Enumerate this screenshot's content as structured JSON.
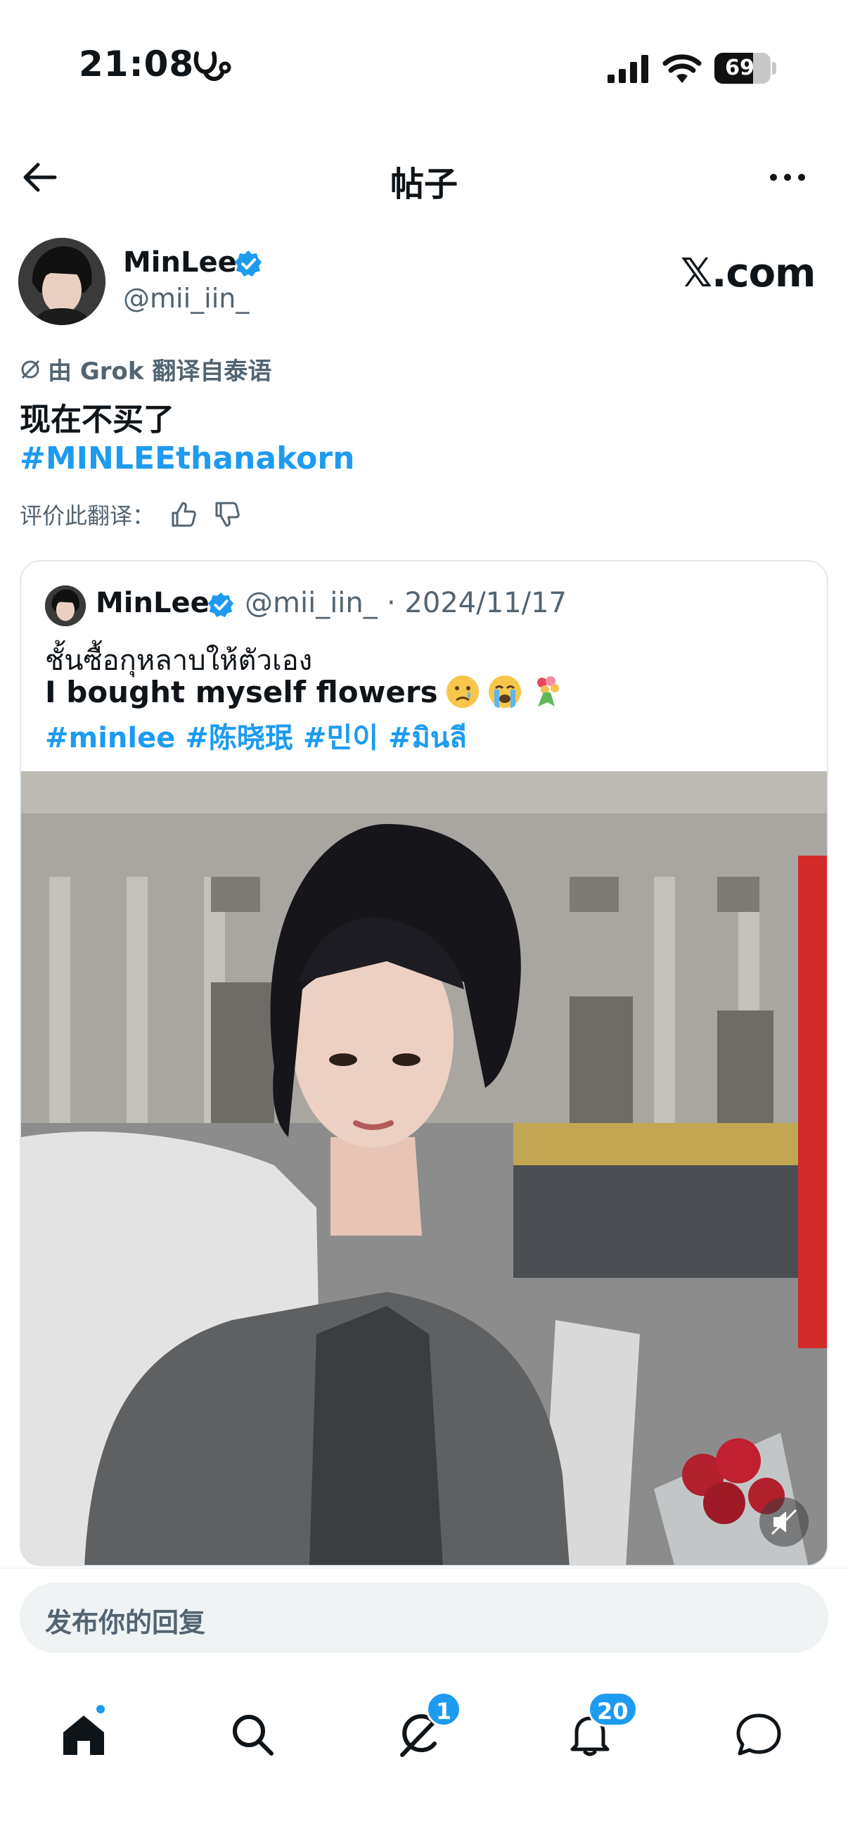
{
  "status": {
    "time": "21:08",
    "battery": "69",
    "battery_level": 0.69
  },
  "header": {
    "title": "帖子"
  },
  "author": {
    "name": "MinLee",
    "handle": "@mii_iin_",
    "site": "𝕏.com"
  },
  "post": {
    "translation_note": "由 Grok 翻译自泰语",
    "text": "现在不买了",
    "hashtag": "#MINLEEthanakorn",
    "rate_label": "评价此翻译："
  },
  "quote": {
    "name": "MinLee",
    "handle": "@mii_iin_",
    "date": "· 2024/11/17",
    "line1": "ชั้นซื้อกุหลาบให้ตัวเอง",
    "line2": "I bought myself flowers",
    "tags": [
      "#minlee",
      "#陈晓珉",
      "#민이",
      "#มินลี"
    ]
  },
  "reply": {
    "placeholder": "发布你的回复"
  },
  "tabbar": {
    "items": [
      {
        "name": "home",
        "badge": ""
      },
      {
        "name": "search",
        "badge": ""
      },
      {
        "name": "grok",
        "badge": "1"
      },
      {
        "name": "notifications",
        "badge": "20"
      },
      {
        "name": "messages",
        "badge": ""
      }
    ]
  },
  "colors": {
    "accent": "#1d9bf0",
    "text": "#0f1419",
    "secondary": "#536471"
  }
}
